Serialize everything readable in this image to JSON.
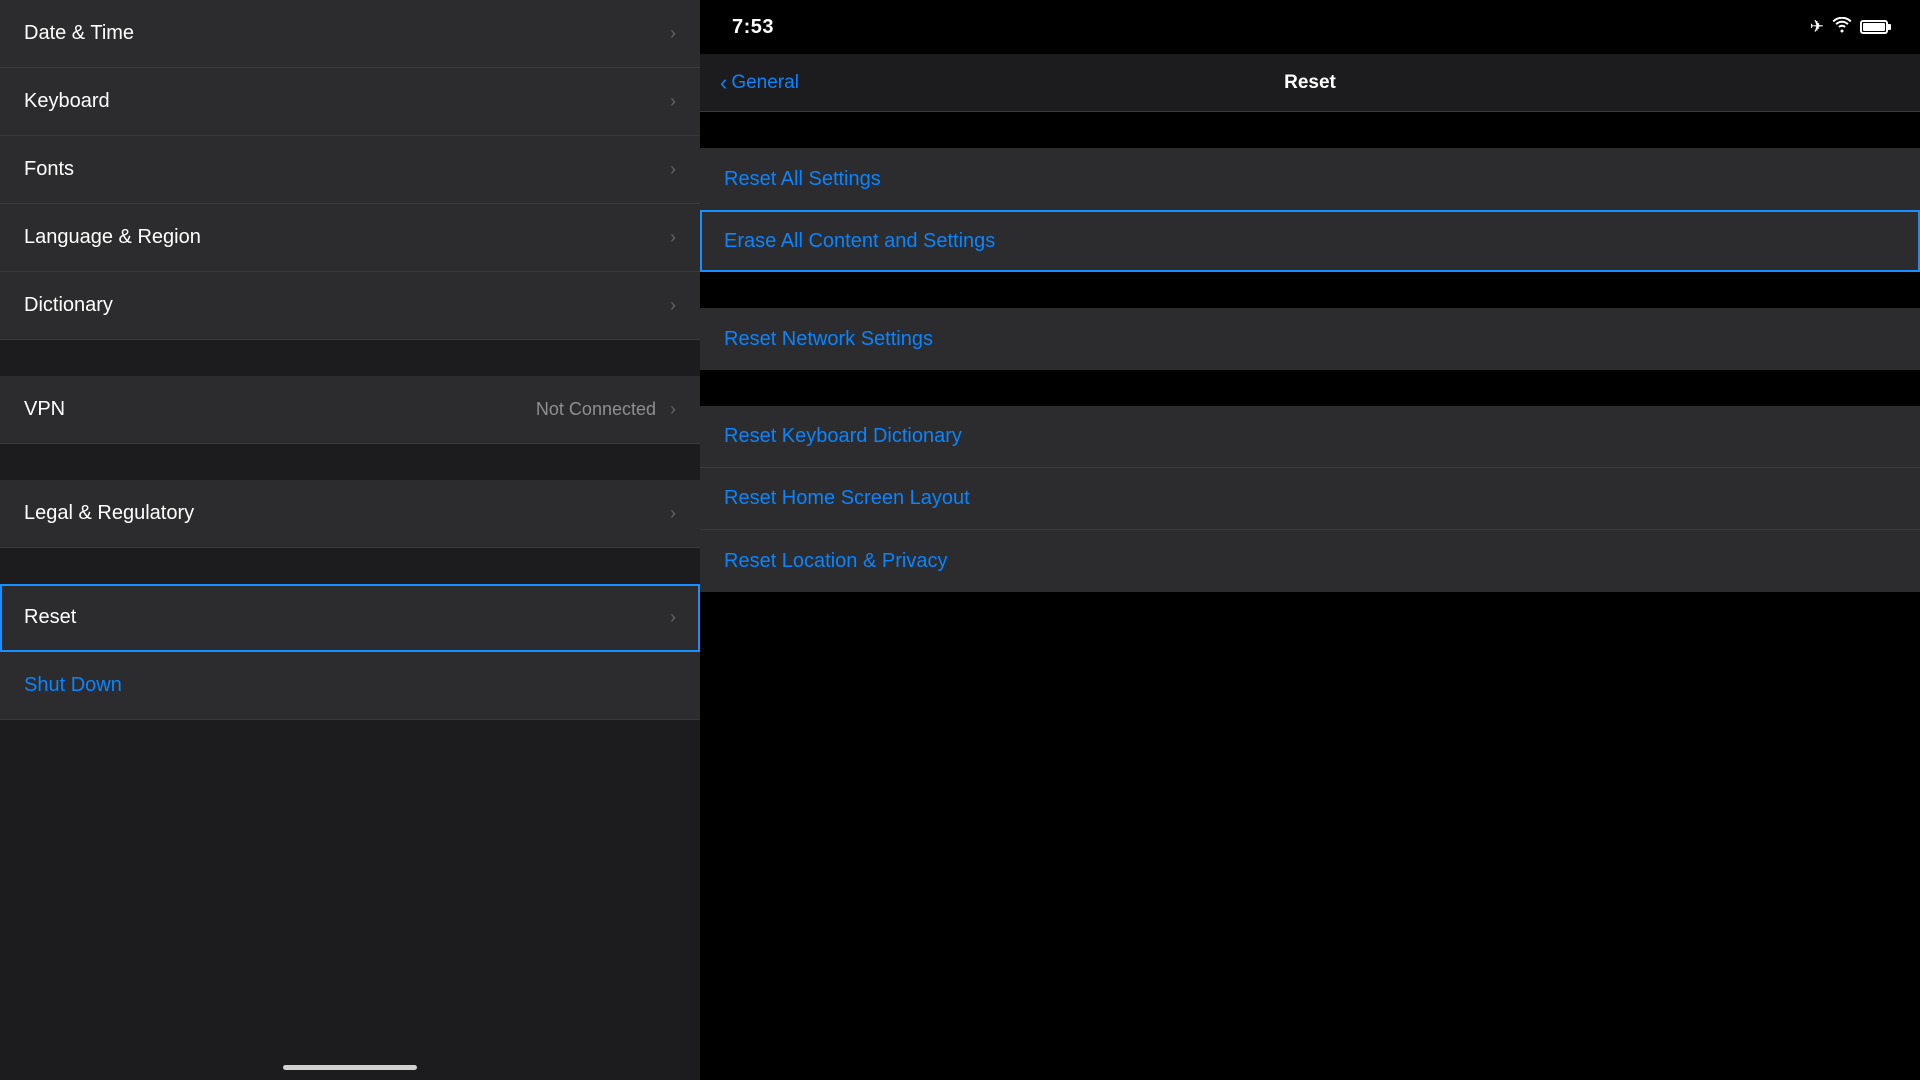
{
  "leftPanel": {
    "items": [
      {
        "id": "date-time",
        "label": "Date & Time",
        "value": "",
        "hasChevron": true
      },
      {
        "id": "keyboard",
        "label": "Keyboard",
        "value": "",
        "hasChevron": true
      },
      {
        "id": "fonts",
        "label": "Fonts",
        "value": "",
        "hasChevron": true
      },
      {
        "id": "language-region",
        "label": "Language & Region",
        "value": "",
        "hasChevron": true
      },
      {
        "id": "dictionary",
        "label": "Dictionary",
        "value": "",
        "hasChevron": true
      }
    ],
    "separator1": true,
    "vpnItem": {
      "id": "vpn",
      "label": "VPN",
      "value": "Not Connected",
      "hasChevron": true
    },
    "separator2": true,
    "legalItem": {
      "id": "legal",
      "label": "Legal & Regulatory",
      "value": "",
      "hasChevron": true
    },
    "separator3": true,
    "resetItem": {
      "id": "reset",
      "label": "Reset",
      "value": "",
      "hasChevron": true,
      "selected": true
    },
    "shutDownItem": {
      "id": "shut-down",
      "label": "Shut Down"
    },
    "homeBar": "—"
  },
  "rightPanel": {
    "statusBar": {
      "time": "7:53"
    },
    "navBar": {
      "backLabel": "General",
      "title": "Reset"
    },
    "resetItems": {
      "group1": [
        {
          "id": "reset-all-settings",
          "label": "Reset All Settings",
          "selected": false
        }
      ],
      "erase": {
        "id": "erase-all",
        "label": "Erase All Content and Settings",
        "selected": true
      },
      "group2": [
        {
          "id": "reset-network",
          "label": "Reset Network Settings",
          "selected": false
        }
      ],
      "group3": [
        {
          "id": "reset-keyboard",
          "label": "Reset Keyboard Dictionary",
          "selected": false
        },
        {
          "id": "reset-home-screen",
          "label": "Reset Home Screen Layout",
          "selected": false
        },
        {
          "id": "reset-location",
          "label": "Reset Location & Privacy",
          "selected": false
        }
      ]
    }
  }
}
